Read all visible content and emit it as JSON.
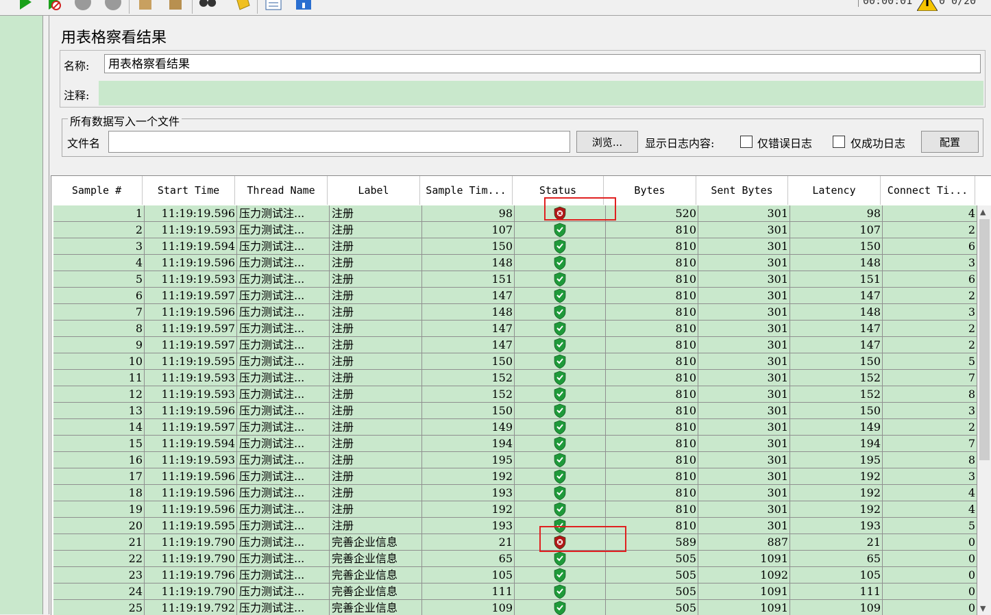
{
  "toolbar": {
    "timer_text": "00:00:01",
    "warning_count_text": "0 0/20",
    "icons": [
      "start-icon",
      "start-no-pause-icon",
      "stop-icon",
      "shutdown-icon",
      "clear-icon",
      "clear-all-icon",
      "search-icon",
      "reset-search-icon",
      "function-helper-icon",
      "help-icon"
    ]
  },
  "panel": {
    "title": "用表格察看结果",
    "name_label": "名称:",
    "name_value": "用表格察看结果",
    "comment_label": "注释:"
  },
  "file_section": {
    "legend": "所有数据写入一个文件",
    "filename_label": "文件名",
    "filename_value": "",
    "browse_button": "浏览...",
    "log_label": "显示日志内容:",
    "errors_only_label": "仅错误日志",
    "success_only_label": "仅成功日志",
    "config_button": "配置"
  },
  "table": {
    "columns": [
      "Sample #",
      "Start Time",
      "Thread Name",
      "Label",
      "Sample Tim...",
      "Status",
      "Bytes",
      "Sent Bytes",
      "Latency",
      "Connect Ti..."
    ],
    "rows": [
      {
        "n": "1",
        "start": "11:19:19.596",
        "thread": "压力测试注...",
        "label": "注册",
        "time": "98",
        "status": "error",
        "bytes": "520",
        "sent": "301",
        "latency": "98",
        "connect": "4"
      },
      {
        "n": "2",
        "start": "11:19:19.593",
        "thread": "压力测试注...",
        "label": "注册",
        "time": "107",
        "status": "ok",
        "bytes": "810",
        "sent": "301",
        "latency": "107",
        "connect": "2"
      },
      {
        "n": "3",
        "start": "11:19:19.594",
        "thread": "压力测试注...",
        "label": "注册",
        "time": "150",
        "status": "ok",
        "bytes": "810",
        "sent": "301",
        "latency": "150",
        "connect": "6"
      },
      {
        "n": "4",
        "start": "11:19:19.596",
        "thread": "压力测试注...",
        "label": "注册",
        "time": "148",
        "status": "ok",
        "bytes": "810",
        "sent": "301",
        "latency": "148",
        "connect": "3"
      },
      {
        "n": "5",
        "start": "11:19:19.593",
        "thread": "压力测试注...",
        "label": "注册",
        "time": "151",
        "status": "ok",
        "bytes": "810",
        "sent": "301",
        "latency": "151",
        "connect": "6"
      },
      {
        "n": "6",
        "start": "11:19:19.597",
        "thread": "压力测试注...",
        "label": "注册",
        "time": "147",
        "status": "ok",
        "bytes": "810",
        "sent": "301",
        "latency": "147",
        "connect": "2"
      },
      {
        "n": "7",
        "start": "11:19:19.596",
        "thread": "压力测试注...",
        "label": "注册",
        "time": "148",
        "status": "ok",
        "bytes": "810",
        "sent": "301",
        "latency": "148",
        "connect": "3"
      },
      {
        "n": "8",
        "start": "11:19:19.597",
        "thread": "压力测试注...",
        "label": "注册",
        "time": "147",
        "status": "ok",
        "bytes": "810",
        "sent": "301",
        "latency": "147",
        "connect": "2"
      },
      {
        "n": "9",
        "start": "11:19:19.597",
        "thread": "压力测试注...",
        "label": "注册",
        "time": "147",
        "status": "ok",
        "bytes": "810",
        "sent": "301",
        "latency": "147",
        "connect": "2"
      },
      {
        "n": "10",
        "start": "11:19:19.595",
        "thread": "压力测试注...",
        "label": "注册",
        "time": "150",
        "status": "ok",
        "bytes": "810",
        "sent": "301",
        "latency": "150",
        "connect": "5"
      },
      {
        "n": "11",
        "start": "11:19:19.593",
        "thread": "压力测试注...",
        "label": "注册",
        "time": "152",
        "status": "ok",
        "bytes": "810",
        "sent": "301",
        "latency": "152",
        "connect": "7"
      },
      {
        "n": "12",
        "start": "11:19:19.593",
        "thread": "压力测试注...",
        "label": "注册",
        "time": "152",
        "status": "ok",
        "bytes": "810",
        "sent": "301",
        "latency": "152",
        "connect": "8"
      },
      {
        "n": "13",
        "start": "11:19:19.596",
        "thread": "压力测试注...",
        "label": "注册",
        "time": "150",
        "status": "ok",
        "bytes": "810",
        "sent": "301",
        "latency": "150",
        "connect": "3"
      },
      {
        "n": "14",
        "start": "11:19:19.597",
        "thread": "压力测试注...",
        "label": "注册",
        "time": "149",
        "status": "ok",
        "bytes": "810",
        "sent": "301",
        "latency": "149",
        "connect": "2"
      },
      {
        "n": "15",
        "start": "11:19:19.594",
        "thread": "压力测试注...",
        "label": "注册",
        "time": "194",
        "status": "ok",
        "bytes": "810",
        "sent": "301",
        "latency": "194",
        "connect": "7"
      },
      {
        "n": "16",
        "start": "11:19:19.593",
        "thread": "压力测试注...",
        "label": "注册",
        "time": "195",
        "status": "ok",
        "bytes": "810",
        "sent": "301",
        "latency": "195",
        "connect": "8"
      },
      {
        "n": "17",
        "start": "11:19:19.596",
        "thread": "压力测试注...",
        "label": "注册",
        "time": "192",
        "status": "ok",
        "bytes": "810",
        "sent": "301",
        "latency": "192",
        "connect": "3"
      },
      {
        "n": "18",
        "start": "11:19:19.596",
        "thread": "压力测试注...",
        "label": "注册",
        "time": "193",
        "status": "ok",
        "bytes": "810",
        "sent": "301",
        "latency": "192",
        "connect": "4"
      },
      {
        "n": "19",
        "start": "11:19:19.596",
        "thread": "压力测试注...",
        "label": "注册",
        "time": "192",
        "status": "ok",
        "bytes": "810",
        "sent": "301",
        "latency": "192",
        "connect": "4"
      },
      {
        "n": "20",
        "start": "11:19:19.595",
        "thread": "压力测试注...",
        "label": "注册",
        "time": "193",
        "status": "ok",
        "bytes": "810",
        "sent": "301",
        "latency": "193",
        "connect": "5"
      },
      {
        "n": "21",
        "start": "11:19:19.790",
        "thread": "压力测试注...",
        "label": "完善企业信息",
        "time": "21",
        "status": "error",
        "bytes": "589",
        "sent": "887",
        "latency": "21",
        "connect": "0"
      },
      {
        "n": "22",
        "start": "11:19:19.790",
        "thread": "压力测试注...",
        "label": "完善企业信息",
        "time": "65",
        "status": "ok",
        "bytes": "505",
        "sent": "1091",
        "latency": "65",
        "connect": "0"
      },
      {
        "n": "23",
        "start": "11:19:19.796",
        "thread": "压力测试注...",
        "label": "完善企业信息",
        "time": "105",
        "status": "ok",
        "bytes": "505",
        "sent": "1092",
        "latency": "105",
        "connect": "0"
      },
      {
        "n": "24",
        "start": "11:19:19.790",
        "thread": "压力测试注...",
        "label": "完善企业信息",
        "time": "111",
        "status": "ok",
        "bytes": "505",
        "sent": "1091",
        "latency": "111",
        "connect": "0"
      },
      {
        "n": "25",
        "start": "11:19:19.792",
        "thread": "压力测试注...",
        "label": "完善企业信息",
        "time": "109",
        "status": "ok",
        "bytes": "505",
        "sent": "1091",
        "latency": "109",
        "connect": "0"
      }
    ]
  },
  "colors": {
    "row_green": "#c9e8cc",
    "ok_shield": "#1f9a3a",
    "error_shield": "#b01818",
    "highlight_box": "#e02020"
  }
}
